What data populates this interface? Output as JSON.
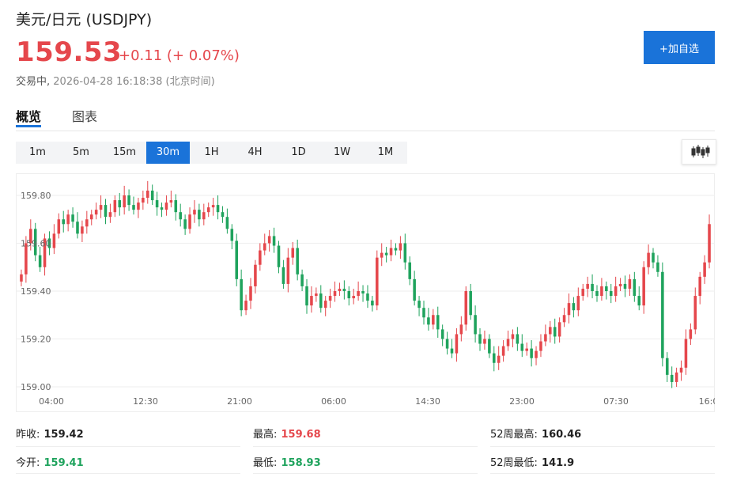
{
  "header": {
    "title": "美元/日元  (USDJPY)",
    "price": "159.53",
    "change": "+0.11 (+ 0.07%)",
    "status": "交易中,",
    "timestamp": "2026-04-28 16:18:38",
    "timezone": "(北京时间)",
    "add_button": "+加自选"
  },
  "tabs": [
    {
      "label": "概览",
      "active": true
    },
    {
      "label": "图表",
      "active": false
    }
  ],
  "periods": [
    "1m",
    "5m",
    "15m",
    "30m",
    "1H",
    "4H",
    "1D",
    "1W",
    "1M"
  ],
  "active_period": "30m",
  "colors": {
    "up": "#e5474c",
    "down": "#1fa35d",
    "accent": "#1a73d9"
  },
  "chart_data": {
    "type": "candlestick",
    "y_ticks": [
      "159.80",
      "159.60",
      "159.40",
      "159.20",
      "159.00"
    ],
    "x_ticks": [
      "04:00",
      "12:30",
      "21:00",
      "06:00",
      "14:30",
      "23:00",
      "07:30",
      "16:0"
    ],
    "ylim": [
      159.0,
      159.8
    ],
    "grid": true
  },
  "stats": [
    [
      {
        "label": "昨收:",
        "value": "159.42",
        "tone": "neutral"
      },
      {
        "label": "最高:",
        "value": "159.68",
        "tone": "up"
      },
      {
        "label": "52周最高:",
        "value": "160.46",
        "tone": "neutral"
      }
    ],
    [
      {
        "label": "今开:",
        "value": "159.41",
        "tone": "down"
      },
      {
        "label": "最低:",
        "value": "158.93",
        "tone": "down"
      },
      {
        "label": "52周最低:",
        "value": "141.9",
        "tone": "neutral"
      }
    ]
  ]
}
